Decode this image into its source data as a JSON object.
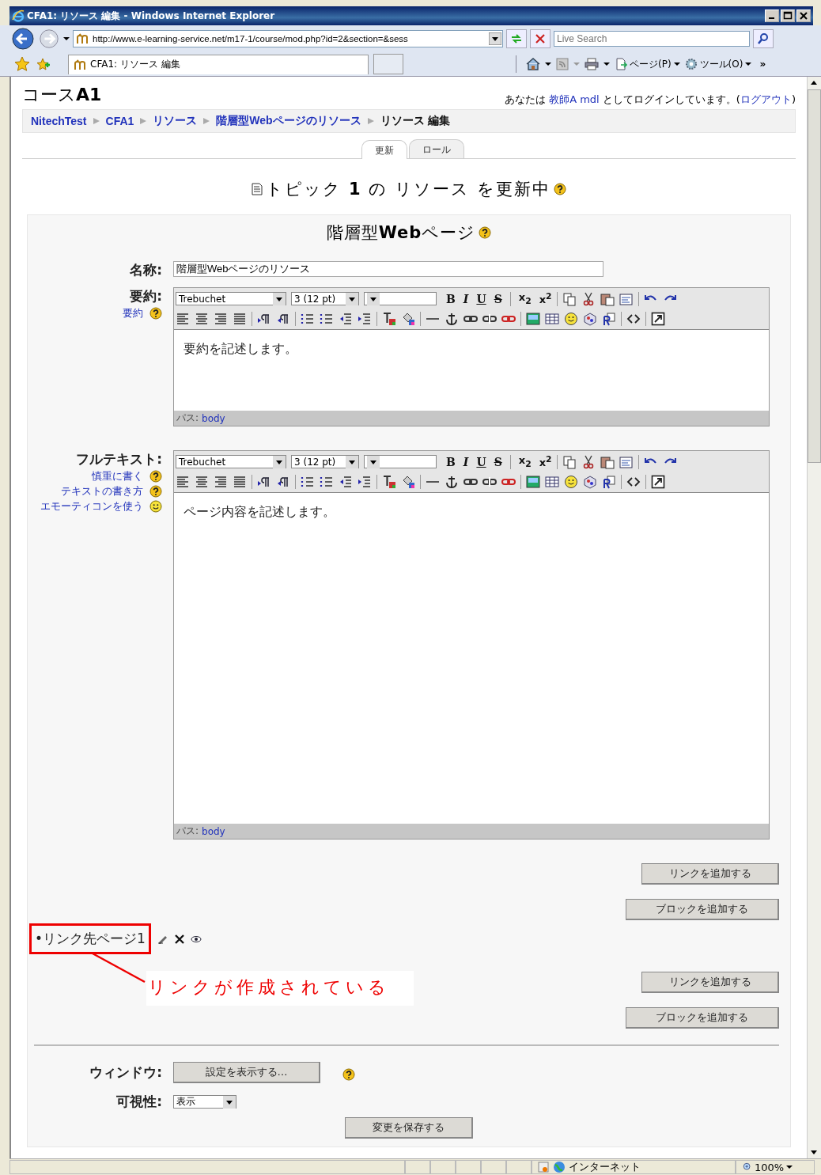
{
  "window": {
    "title": "CFA1: リソース 編集 - Windows Internet Explorer"
  },
  "address_bar": {
    "url": "http://www.e-learning-service.net/m17-1/course/mod.php?id=2&section=&sess",
    "search_placeholder": "Live Search"
  },
  "tab": {
    "title": "CFA1: リソース 編集"
  },
  "command_bar": {
    "page_menu": "ページ(P)",
    "tools_menu": "ツール(O)",
    "more": "»"
  },
  "header": {
    "course": "コース**A1**",
    "login_prefix": "あなたは",
    "user": "教師A mdl",
    "login_middle": "としてログインしています。(",
    "logout": "ログアウト",
    "login_suffix": ")"
  },
  "breadcrumb": [
    {
      "label": "NitechTest",
      "kind": "link"
    },
    {
      "label": "CFA1",
      "kind": "link"
    },
    {
      "label": "リソース",
      "kind": "link"
    },
    {
      "label": "階層型Webページのリソース",
      "kind": "link"
    },
    {
      "label": "リソース 編集",
      "kind": "current"
    }
  ],
  "tabs": [
    {
      "label": "更新",
      "selected": true
    },
    {
      "label": "ロール",
      "selected": false
    }
  ],
  "heading": "トピック **1** の リソース を更新中",
  "section_title": "階層型**Web**ページ",
  "name_field": {
    "label": "名称:",
    "value": "階層型Webページのリソース"
  },
  "editors": [
    {
      "label": "要約:",
      "help_links": [
        {
          "label": "要約",
          "kind": "help"
        }
      ],
      "font": "Trebuchet",
      "size": "3 (12 pt)",
      "format_buttons": [
        "B",
        "I",
        "U",
        "S",
        "x$_{2}$",
        "x$^{2}$"
      ],
      "content": "要約を記述します。",
      "path_label": "パス:",
      "path": "body",
      "kind": "short"
    },
    {
      "label": "フルテキスト:",
      "help_links": [
        {
          "label": "慎重に書く",
          "kind": "help"
        },
        {
          "label": "テキストの書き方",
          "kind": "help"
        },
        {
          "label": "エモーティコンを使う",
          "kind": "smiley"
        }
      ],
      "font": "Trebuchet",
      "size": "3 (12 pt)",
      "format_buttons": [
        "B",
        "I",
        "U",
        "S",
        "x$_{2}$",
        "x$^{2}$"
      ],
      "content": "ページ内容を記述します。",
      "path_label": "パス:",
      "path": "body",
      "kind": "tall"
    }
  ],
  "buttons_before": [
    {
      "kind": "link",
      "label": "リンクを追加する"
    },
    {
      "kind": "block",
      "label": "ブロックを追加する"
    }
  ],
  "link_item": {
    "label": "•リンク先ページ1",
    "annotation": "リンクが作成されている"
  },
  "buttons_after": [
    {
      "kind": "link",
      "label": "リンクを追加する"
    },
    {
      "kind": "block",
      "label": "ブロックを追加する"
    }
  ],
  "window_setting": {
    "label": "ウィンドウ:",
    "button": "設定を表示する…"
  },
  "visibility": {
    "label": "可視性:",
    "value": "表示"
  },
  "save_button": "変更を保存する",
  "status_bar": {
    "zone": "インターネット",
    "zoom": "100%"
  }
}
